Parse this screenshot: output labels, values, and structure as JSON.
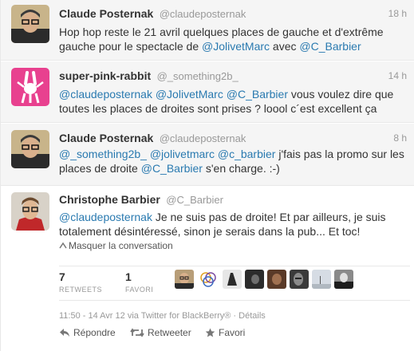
{
  "tweets": [
    {
      "fullname": "Claude Posternak",
      "username": "@claudeposternak",
      "time": "18 h",
      "line1": [
        "Hop hop reste le 21 avril quelques places de gauche et d'extrême"
      ],
      "line2": [
        "gauche pour le spectacle de ",
        "@JolivetMarc",
        " avec ",
        "@C_Barbier"
      ]
    },
    {
      "fullname": "super-pink-rabbit",
      "username": "@_something2b_",
      "time": "14 h",
      "line1": [
        "@claudeposternak",
        " ",
        "@JolivetMarc",
        " ",
        "@C_Barbier",
        " vous voulez dire que"
      ],
      "line2": [
        "toutes les places de droites sont prises ? loool c´est excellent ça"
      ]
    },
    {
      "fullname": "Claude Posternak",
      "username": "@claudeposternak",
      "time": "8 h",
      "line1": [
        "@_something2b_",
        " ",
        "@jolivetmarc",
        " ",
        "@c_barbier",
        " j'fais pas la promo sur les"
      ],
      "line2": [
        "places de droite ",
        "@C_Barbier",
        " s'en charge. :-)"
      ]
    },
    {
      "fullname": "Christophe Barbier",
      "username": "@C_Barbier",
      "line1": [
        "@claudeposternak",
        " Je ne suis pas de droite! Et par ailleurs, je suis"
      ],
      "line2": [
        "totalement désintéressé, sinon je serais dans la pub... Et toc!"
      ],
      "hide_conversation": "Masquer la conversation",
      "retweets_count": "7",
      "retweets_label": "RETWEETS",
      "favorites_count": "1",
      "favorites_label": "FAVORI",
      "meta_time": "11:50 - 14 Avr 12",
      "meta_via": "via Twitter for BlackBerry®",
      "meta_details": "Détails",
      "action_reply": "Répondre",
      "action_retweet": "Retweeter",
      "action_favorite": "Favori"
    }
  ],
  "colors": {
    "link": "#2a7ab0",
    "highlight_bg": "#7ab0d6",
    "muted": "#999999",
    "text": "#333333"
  },
  "icons": [
    "caret-icon",
    "reply-icon",
    "retweet-icon",
    "star-icon"
  ],
  "retweeter_avatar_count": 8
}
